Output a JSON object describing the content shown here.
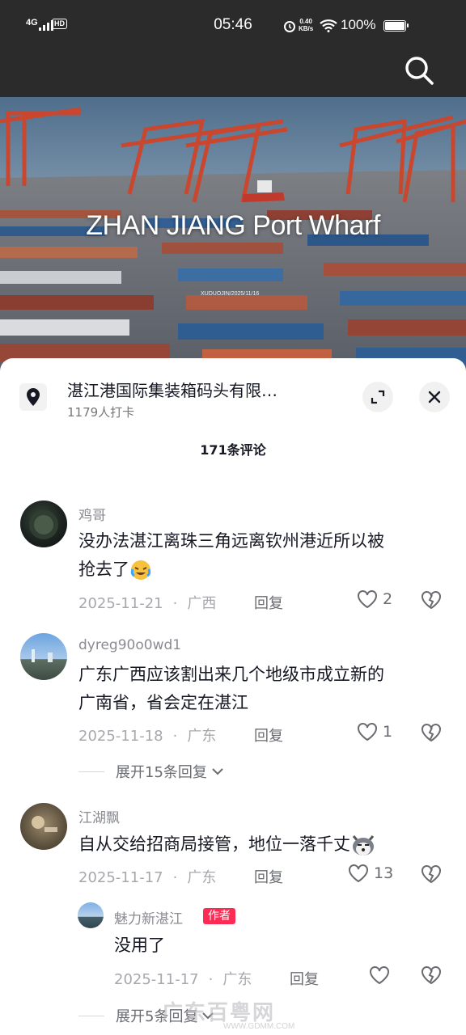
{
  "status_bar": {
    "network": "4G",
    "hd": "HD",
    "time": "05:46",
    "speed_value": "0.40",
    "speed_unit": "KB/s",
    "battery": "100%"
  },
  "hero": {
    "title": "ZHAN JIANG Port Wharf",
    "stamp": "XUDUOJIN/2025/11/16"
  },
  "location": {
    "name": "湛江港国际集装箱码头有限…",
    "checkins": "1179人打卡"
  },
  "comments_header": "171条评论",
  "comments": [
    {
      "user": "鸡哥",
      "text_line1": "没办法湛江离珠三角远离钦州港近所以被",
      "text_line2": "抢去了",
      "date": "2025-11-21",
      "region": "广西",
      "reply": "回复",
      "likes": "2"
    },
    {
      "user": "dyreg90o0wd1",
      "text_line1": "广东广西应该割出来几个地级市成立新的",
      "text_line2": "广南省，省会定在湛江",
      "date": "2025-11-18",
      "region": "广东",
      "reply": "回复",
      "likes": "1",
      "expand": "展开15条回复"
    },
    {
      "user": "江湖飘",
      "text_line1": "自从交给招商局接管，地位一落千丈",
      "date": "2025-11-17",
      "region": "广东",
      "reply": "回复",
      "likes": "13",
      "sub_reply": {
        "user": "魅力新湛江",
        "tag": "作者",
        "text": "没用了",
        "date": "2025-11-17",
        "region": "广东",
        "reply": "回复"
      },
      "expand": "展开5条回复"
    }
  ],
  "watermark": "广东百粤网",
  "watermark_sub": "WWW.GDMM.COM",
  "colors": {
    "accent": "#fe2c55",
    "status_bg": "#2b2b2b"
  }
}
